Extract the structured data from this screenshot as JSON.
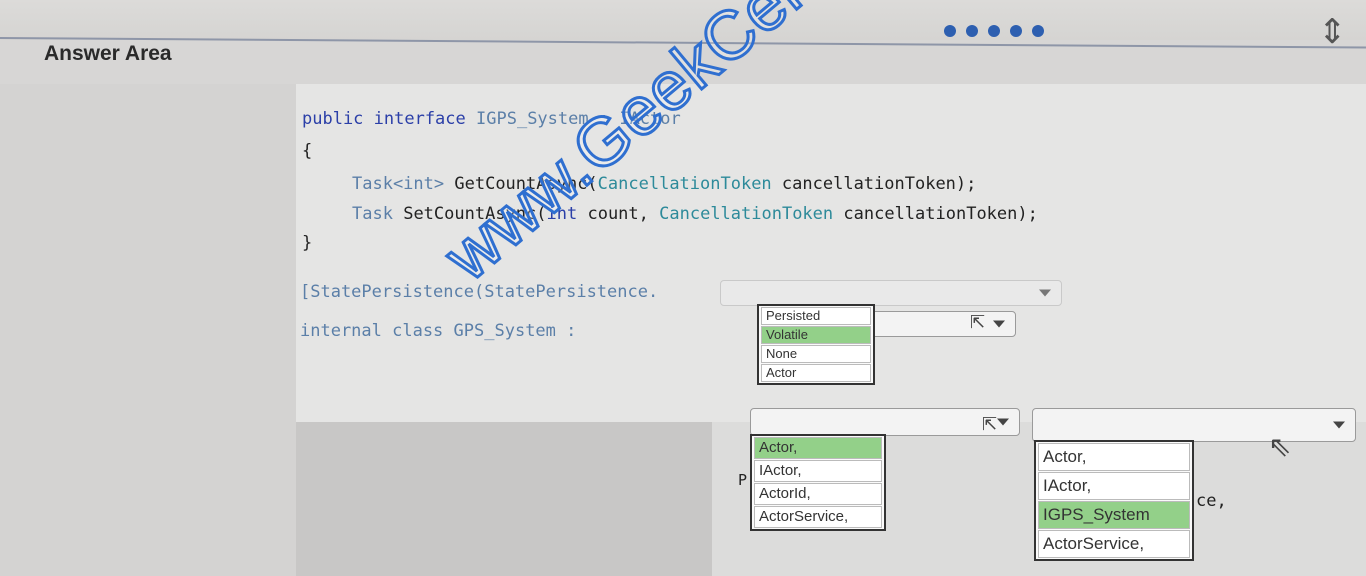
{
  "header": {
    "title": "Answer Area"
  },
  "code": {
    "line1_kw": "public interface",
    "line1_name": "IGPS_System",
    "line1_rest": ": IActor",
    "open_brace": "{",
    "line3_type": "Task<int>",
    "line3_method": "GetCountAsync(",
    "line3_param_type": "CancellationToken",
    "line3_rest": "cancellationToken);",
    "line4_type": "Task",
    "line4_method": "SetCountAsync(",
    "line4_int": "int",
    "line4_count": "count,",
    "line4_param_type": "CancellationToken",
    "line4_rest": "cancellationToken);",
    "close_brace": "}",
    "attr_line": "[StatePersistence(StatePersistence.",
    "class_kw": "internal class",
    "class_name": "GPS_System :",
    "partial_p": "P",
    "partial_ce": "ce,"
  },
  "dropdown1": {
    "options": [
      "Persisted",
      "Volatile",
      "None",
      "Actor"
    ],
    "selected_index": 1
  },
  "dropdown2": {
    "options": [
      "Actor,",
      "IActor,",
      "ActorId,",
      "ActorService,"
    ],
    "selected_index": 0
  },
  "dropdown3": {
    "options": [
      "Actor,",
      "IActor,",
      "IGPS_System",
      "ActorService,"
    ],
    "selected_index": 2
  },
  "watermark": "www.GeekCert.com",
  "colors": {
    "selected": "#93d089",
    "dots": "#2d5fb0",
    "watermark": "#2f6fd0"
  }
}
